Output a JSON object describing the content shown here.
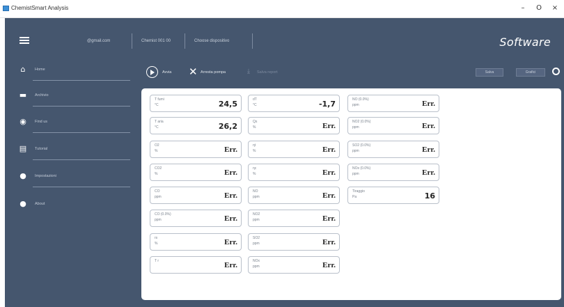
{
  "window": {
    "title": "ChemistSmart Analysis",
    "controls": [
      "–",
      "O",
      "×"
    ]
  },
  "header": {
    "items": [
      "@gmail.com",
      "Chemist 001 00",
      "Choose dispositivo"
    ],
    "brand": "Software"
  },
  "sidebar": {
    "items": [
      {
        "icon": "home-icon",
        "label": "Home"
      },
      {
        "icon": "archive-icon",
        "label": "Archivio"
      },
      {
        "icon": "location-icon",
        "label": "Find us"
      },
      {
        "icon": "document-icon",
        "label": "Tutorial"
      },
      {
        "icon": "settings-ring-icon",
        "label": "Impostazioni"
      },
      {
        "icon": "info-icon",
        "label": "About"
      }
    ]
  },
  "toolbar": {
    "start_label": "Avvia",
    "stop_label": "Arresta pompa",
    "save_label": "Salva report",
    "right_btn_1": "Salva",
    "right_btn_2": "Grafici"
  },
  "cards": [
    {
      "name": "T fumi",
      "unit": "°C",
      "value": "24,5"
    },
    {
      "name": "T aria",
      "unit": "°C",
      "value": "26,2"
    },
    {
      "name": "O2",
      "unit": "%",
      "value": "Err."
    },
    {
      "name": "CO2",
      "unit": "%",
      "value": "Err."
    },
    {
      "name": "CO",
      "unit": "ppm",
      "value": "Err."
    },
    {
      "name": "CO (0.0%)",
      "unit": "ppm",
      "value": "Err."
    },
    {
      "name": "rs",
      "unit": "%",
      "value": "Err."
    },
    {
      "name": "T r",
      "unit": "",
      "value": "Err."
    },
    {
      "name": "dT",
      "unit": "°C",
      "value": "-1,7"
    },
    {
      "name": "Qs",
      "unit": "%",
      "value": "Err."
    },
    {
      "name": "ηt",
      "unit": "%",
      "value": "Err."
    },
    {
      "name": "ηc",
      "unit": "%",
      "value": "Err."
    },
    {
      "name": "NO",
      "unit": "ppm",
      "value": "Err."
    },
    {
      "name": "NO2",
      "unit": "ppm",
      "value": "Err."
    },
    {
      "name": "SO2",
      "unit": "ppm",
      "value": "Err."
    },
    {
      "name": "NOx",
      "unit": "ppm",
      "value": "Err."
    },
    {
      "name": "NO (0.0%)",
      "unit": "ppm",
      "value": "Err."
    },
    {
      "name": "NO2 (0.0%)",
      "unit": "ppm",
      "value": "Err."
    },
    {
      "name": "SO2 (0.0%)",
      "unit": "ppm",
      "value": "Err."
    },
    {
      "name": "NOx (0.0%)",
      "unit": "ppm",
      "value": "Err."
    },
    {
      "name": "Tiraggio",
      "unit": "Pa",
      "value": "16"
    }
  ]
}
